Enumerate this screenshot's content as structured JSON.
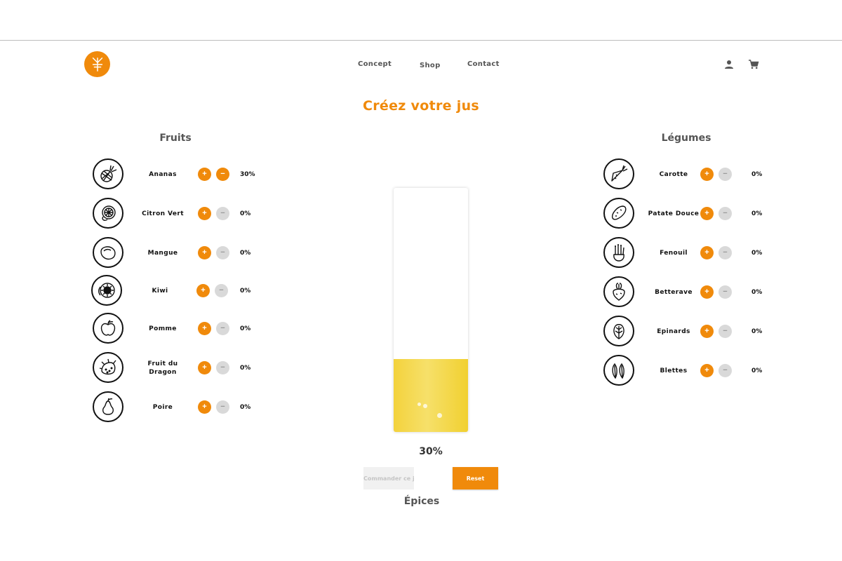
{
  "header": {
    "nav": {
      "concept": "Concept",
      "shop": "Shop",
      "contact": "Contact"
    },
    "icons": {
      "logo": "brand-logo-icon",
      "account": "user-icon",
      "cart": "cart-icon"
    }
  },
  "title": "Créez votre jus",
  "fruits": {
    "title": "Fruits",
    "items": [
      {
        "name": "Ananas",
        "pct": "30%",
        "icon": "pineapple-icon"
      },
      {
        "name": "Citron Vert",
        "pct": "0%",
        "icon": "lime-icon"
      },
      {
        "name": "Mangue",
        "pct": "0%",
        "icon": "mango-icon"
      },
      {
        "name": "Kiwi",
        "pct": "0%",
        "icon": "kiwi-icon"
      },
      {
        "name": "Pomme",
        "pct": "0%",
        "icon": "apple-icon"
      },
      {
        "name": "Fruit du Dragon",
        "pct": "0%",
        "icon": "dragon-fruit-icon"
      },
      {
        "name": "Poire",
        "pct": "0%",
        "icon": "pear-icon"
      }
    ]
  },
  "vegetables": {
    "title": "Légumes",
    "items": [
      {
        "name": "Carotte",
        "pct": "0%",
        "icon": "carrot-icon"
      },
      {
        "name": "Patate Douce",
        "pct": "0%",
        "icon": "sweet-potato-icon"
      },
      {
        "name": "Fenouil",
        "pct": "0%",
        "icon": "fennel-icon"
      },
      {
        "name": "Betterave",
        "pct": "0%",
        "icon": "beetroot-icon"
      },
      {
        "name": "Epinards",
        "pct": "0%",
        "icon": "spinach-icon"
      },
      {
        "name": "Blettes",
        "pct": "0%",
        "icon": "chard-icon"
      }
    ]
  },
  "controls": {
    "plus": "+",
    "minus": "−"
  },
  "glass": {
    "fill_fraction": 0.3,
    "total_label": "30%",
    "juice_color": "#f3d23c"
  },
  "actions": {
    "order": "Commander ce jus",
    "reset": "Reset"
  },
  "spices_title": "Épices",
  "colors": {
    "accent": "#f08a0b",
    "disabled": "#d9d9d9"
  }
}
